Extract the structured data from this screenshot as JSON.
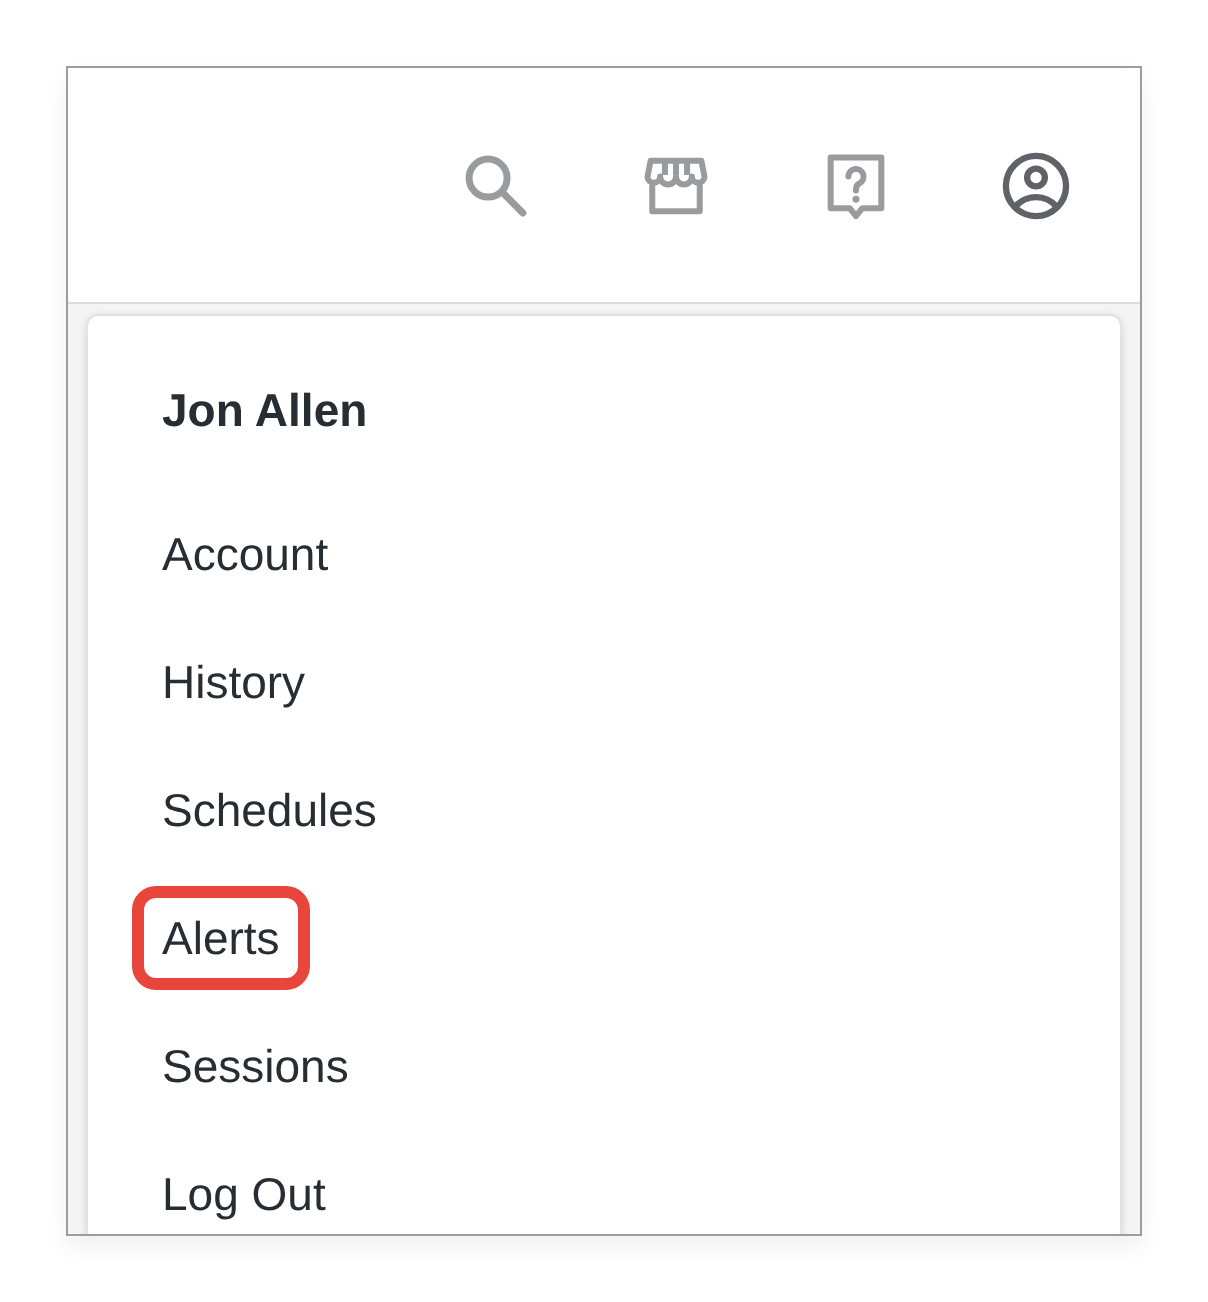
{
  "header": {
    "icons": [
      {
        "kind": "search"
      },
      {
        "kind": "store"
      },
      {
        "kind": "help"
      },
      {
        "kind": "account"
      }
    ]
  },
  "user_menu": {
    "user_name": "Jon Allen",
    "items": [
      {
        "label": "Account",
        "highlighted": false
      },
      {
        "label": "History",
        "highlighted": false
      },
      {
        "label": "Schedules",
        "highlighted": false
      },
      {
        "label": "Alerts",
        "highlighted": true
      },
      {
        "label": "Sessions",
        "highlighted": false
      },
      {
        "label": "Log Out",
        "highlighted": false
      }
    ]
  }
}
